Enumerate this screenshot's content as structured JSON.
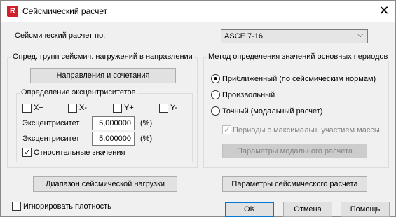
{
  "window": {
    "title": "Сейсмический расчет",
    "app_icon_letter": "R",
    "close_glyph": "✕"
  },
  "code_row": {
    "label": "Сейсмический расчет по:",
    "selected": "ASCE 7-16",
    "arrow": "⌵"
  },
  "left_group": {
    "title": "Опред. групп сейсмич. нагружений в направлении",
    "directions_button": "Направления и сочетания",
    "ecc_group": {
      "title": "Определение эксцентриситетов",
      "checkboxes": [
        {
          "label": "X+",
          "checked": false
        },
        {
          "label": "X-",
          "checked": false
        },
        {
          "label": "Y+",
          "checked": false
        },
        {
          "label": "Y-",
          "checked": false
        }
      ],
      "rows": [
        {
          "label": "Эксцентриситет",
          "value": "5,000000",
          "unit": "(%)"
        },
        {
          "label": "Эксцентриситет",
          "value": "5,000000",
          "unit": "(%)"
        }
      ],
      "relative_values": {
        "label": "Относительные значения",
        "checked": true
      }
    }
  },
  "right_group": {
    "title": "Метод определения значений основных периодов",
    "radios": [
      {
        "label": "Приближенный (по сейсмическим нормам)",
        "selected": true
      },
      {
        "label": "Произвольный",
        "selected": false
      },
      {
        "label": "Точный (модальный расчет)",
        "selected": false
      }
    ],
    "max_mass_periods": {
      "label": "Периоды с максимальн. участием массы",
      "checked": true,
      "disabled": true
    },
    "modal_params_button": "Параметры модального расчета"
  },
  "bottom": {
    "range_button": "Диапазон сейсмической нагрузки",
    "params_button": "Параметры сейсмического расчета",
    "ignore_density": {
      "label": "Игнорировать плотность",
      "checked": false
    },
    "ok": "OK",
    "cancel": "Отмена",
    "help": "Помощь"
  },
  "colors": {
    "accent": "#0078d7",
    "app_icon": "#d0202c"
  }
}
